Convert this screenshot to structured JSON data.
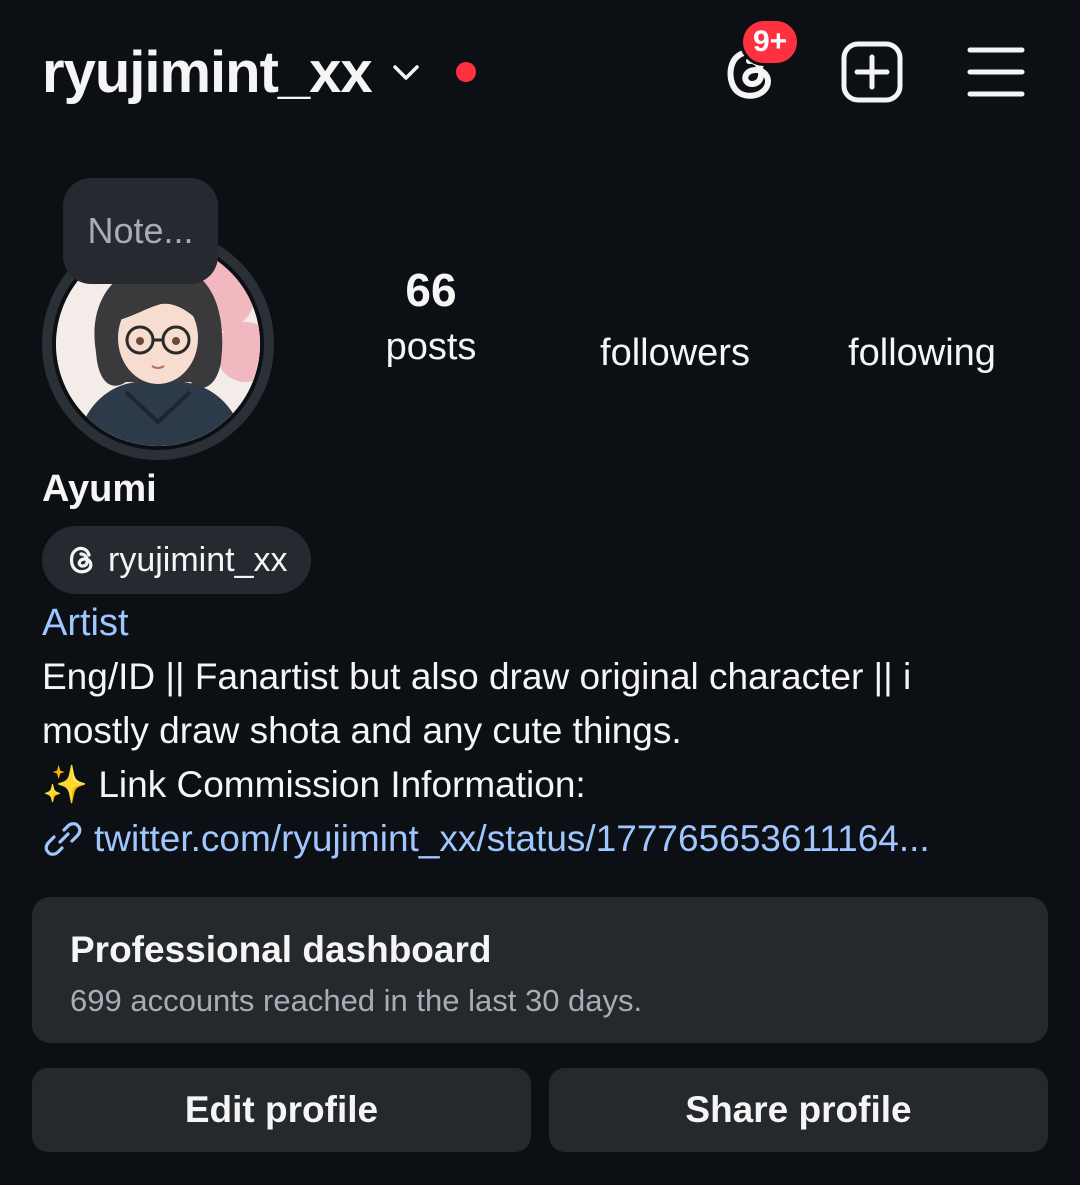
{
  "header": {
    "username": "ryujimint_xx",
    "chevron_icon": "chevron-down-icon",
    "threads_badge": "9+",
    "icons": [
      "threads-icon",
      "add-post-icon",
      "hamburger-menu-icon"
    ],
    "accent_red": "#ff3040"
  },
  "profile": {
    "note_placeholder": "Note...",
    "stats": {
      "posts_count": "66",
      "posts_label": "posts",
      "followers_label": "followers",
      "following_label": "following"
    },
    "display_name": "Ayumi",
    "threads_handle": "ryujimint_xx",
    "category": "Artist",
    "bio_lines": [
      "Eng/ID || Fanartist but also draw original character || i",
      "mostly draw shota and any cute things.",
      "✨ Link Commission Information:"
    ],
    "link": "twitter.com/ryujimint_xx/status/177765653611164..."
  },
  "dashboard": {
    "title": "Professional dashboard",
    "subtitle": "699 accounts reached in the last 30 days."
  },
  "actions": {
    "edit_label": "Edit profile",
    "share_label": "Share profile"
  },
  "colors": {
    "background": "#0c1014",
    "surface": "#25292e",
    "link_blue": "#a0c6ff"
  }
}
